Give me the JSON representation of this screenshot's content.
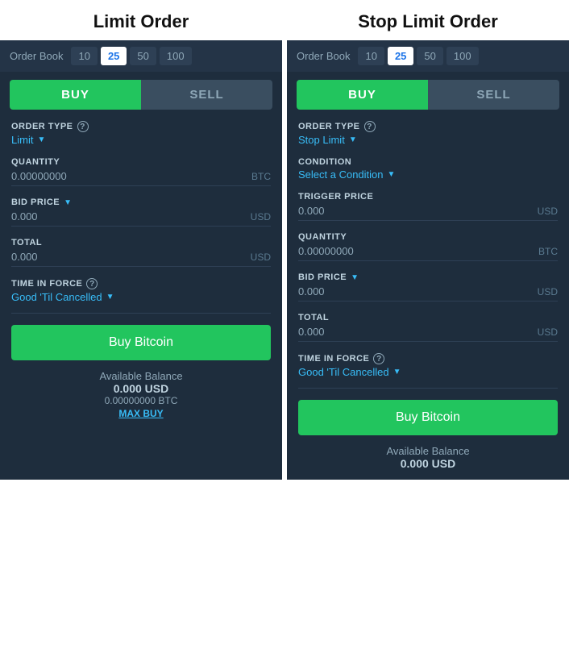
{
  "left": {
    "title": "Limit Order",
    "orderBook": {
      "label": "Order Book",
      "options": [
        "10",
        "25",
        "50",
        "100"
      ],
      "active": "25"
    },
    "buyLabel": "BUY",
    "sellLabel": "SELL",
    "orderType": {
      "label": "ORDER TYPE",
      "value": "Limit"
    },
    "quantity": {
      "label": "QUANTITY",
      "value": "0.00000000",
      "unit": "BTC"
    },
    "bidPrice": {
      "label": "BID PRICE",
      "value": "0.000",
      "unit": "USD"
    },
    "total": {
      "label": "TOTAL",
      "value": "0.000",
      "unit": "USD"
    },
    "timeInForce": {
      "label": "TIME IN FORCE",
      "value": "Good 'Til Cancelled"
    },
    "buyButton": "Buy Bitcoin",
    "balanceLabel": "Available Balance",
    "balanceUSD": "0.000  USD",
    "balanceBTC": "0.00000000 BTC",
    "maxBuy": "MAX BUY"
  },
  "right": {
    "title": "Stop Limit Order",
    "orderBook": {
      "label": "Order Book",
      "options": [
        "10",
        "25",
        "50",
        "100"
      ],
      "active": "25"
    },
    "buyLabel": "BUY",
    "sellLabel": "SELL",
    "orderType": {
      "label": "ORDER TYPE",
      "value": "Stop Limit"
    },
    "condition": {
      "label": "CONDITION",
      "value": "Select a Condition"
    },
    "triggerPrice": {
      "label": "TRIGGER PRICE",
      "value": "0.000",
      "unit": "USD"
    },
    "quantity": {
      "label": "QUANTITY",
      "value": "0.00000000",
      "unit": "BTC"
    },
    "bidPrice": {
      "label": "BID PRICE",
      "value": "0.000",
      "unit": "USD"
    },
    "total": {
      "label": "TOTAL",
      "value": "0.000",
      "unit": "USD"
    },
    "timeInForce": {
      "label": "TIME IN FORCE",
      "value": "Good 'Til Cancelled"
    },
    "buyButton": "Buy Bitcoin",
    "balanceLabel": "Available Balance",
    "balanceUSD": "0.000  USD"
  }
}
